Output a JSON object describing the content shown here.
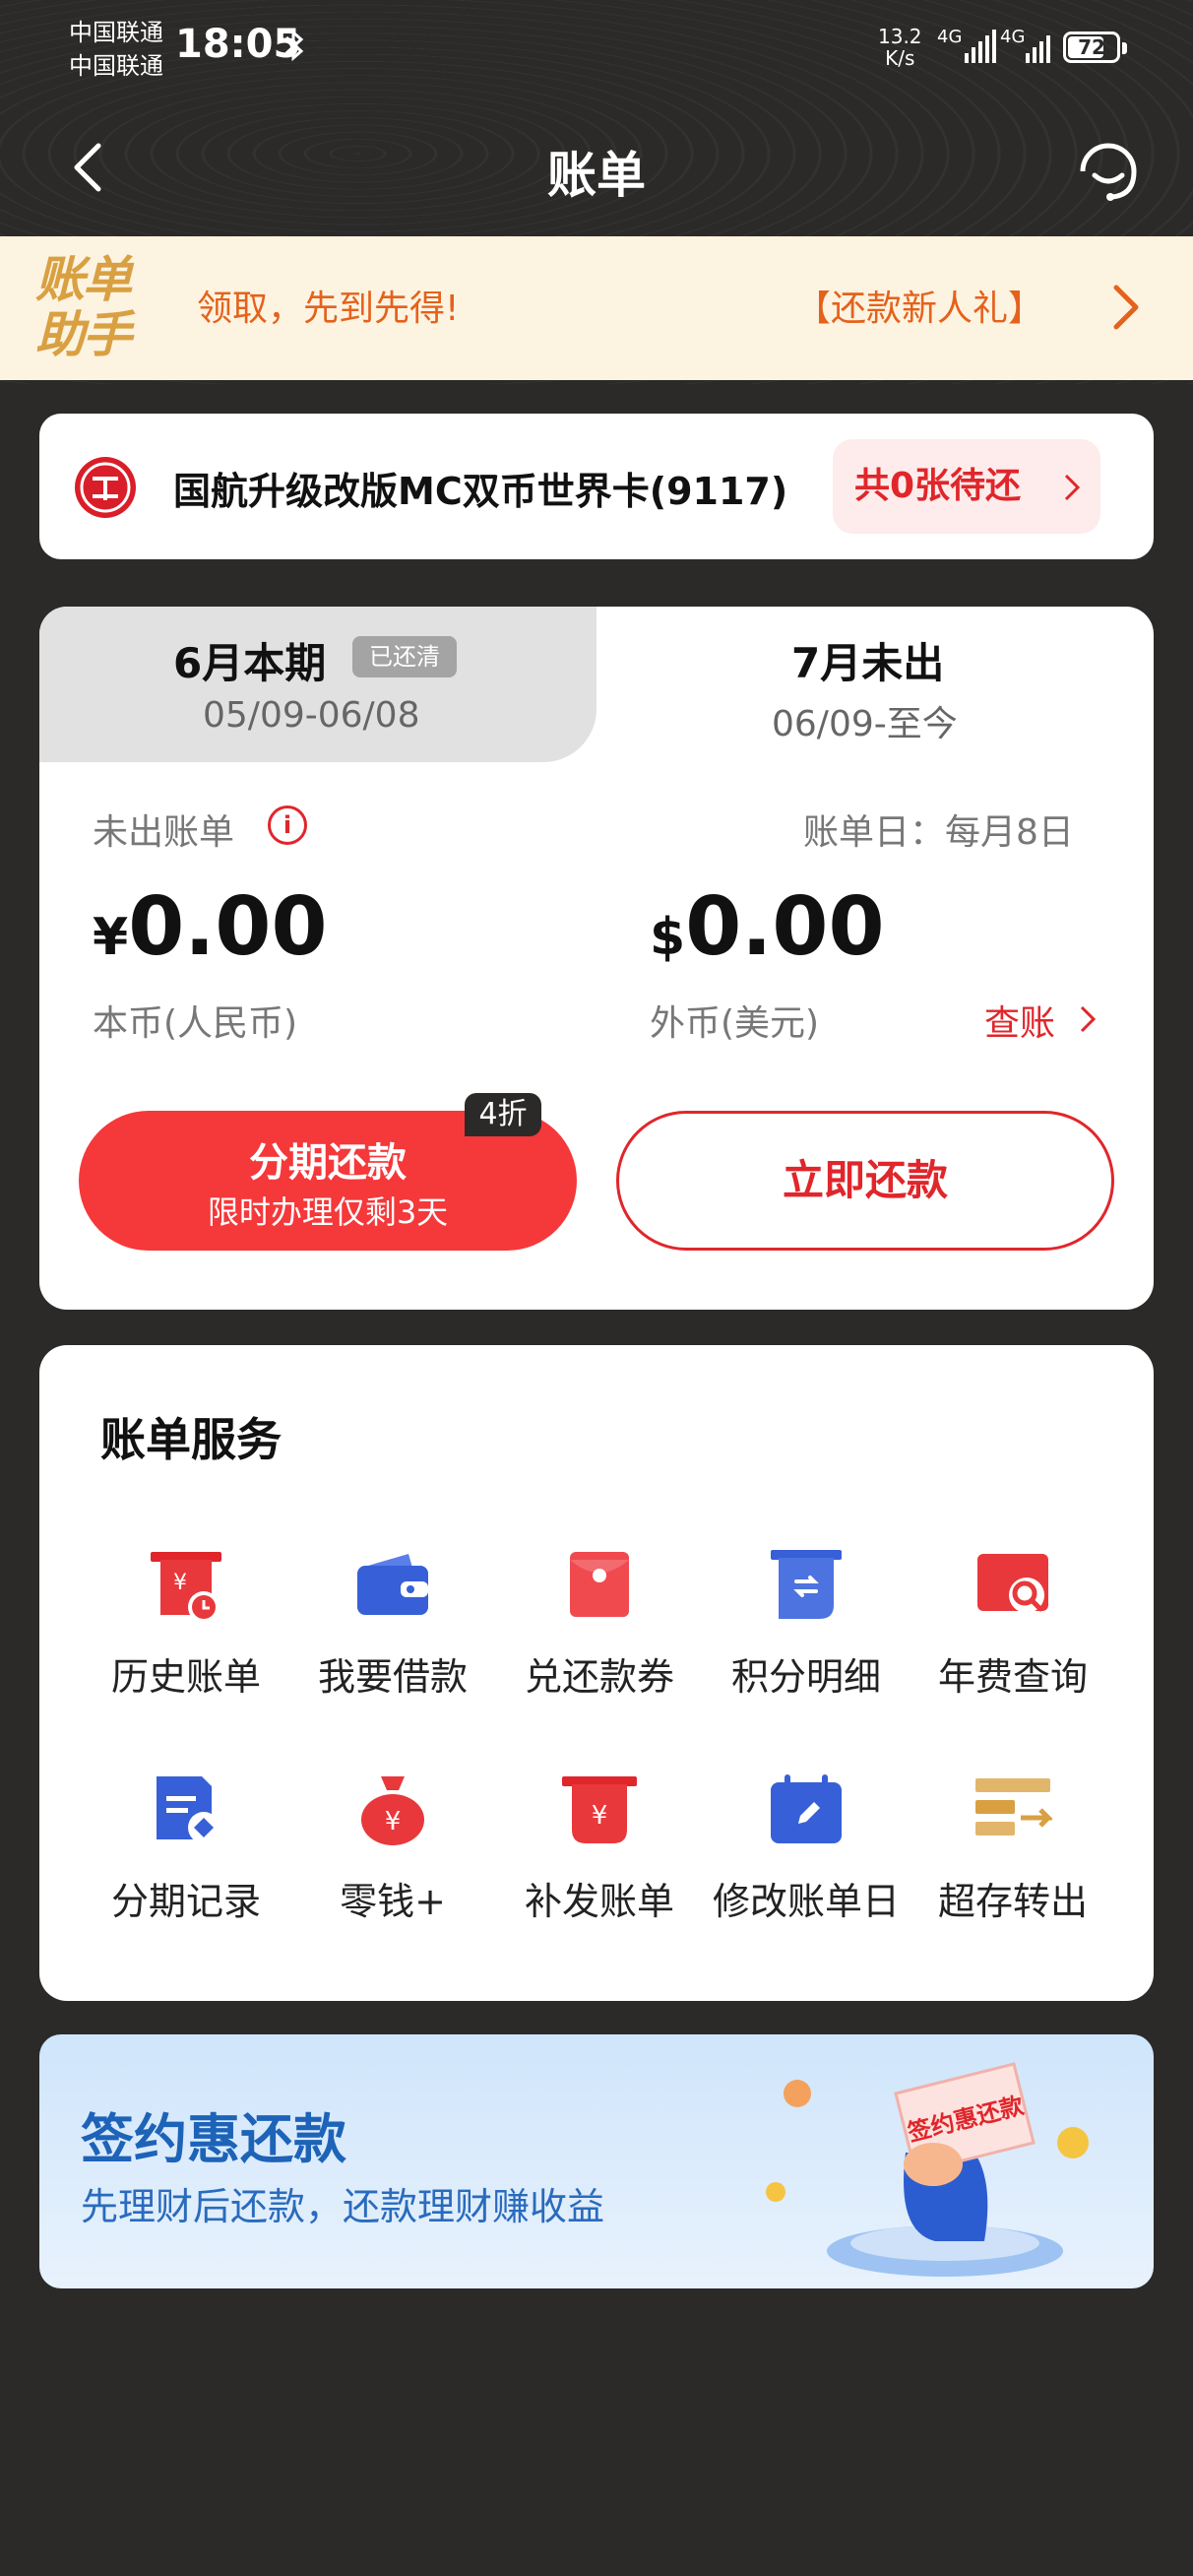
{
  "status_bar": {
    "carrier_1": "中国联通",
    "carrier_2": "中国联通",
    "time": "18:05",
    "net_speed_value": "13.2",
    "net_speed_unit": "K/s",
    "signal_1": "4G",
    "signal_2": "4G",
    "battery": "72"
  },
  "nav": {
    "title": "账单"
  },
  "banner": {
    "logo_line_1": "账单",
    "logo_line_2": "助手",
    "text_left": "领取，先到先得!",
    "text_right": "【还款新人礼】"
  },
  "card": {
    "name": "国航升级改版MC双币世界卡(9117)",
    "pending": "共0张待还"
  },
  "bill": {
    "tab_current_title": "6月本期",
    "tab_current_badge": "已还清",
    "tab_current_range": "05/09-06/08",
    "tab_next_title": "7月未出",
    "tab_next_range": "06/09-至今",
    "status_label": "未出账单",
    "bill_day": "账单日：每月8日",
    "cny_symbol": "¥",
    "cny_amount": "0.00",
    "cny_label": "本币(人民币)",
    "usd_symbol": "$",
    "usd_amount": "0.00",
    "usd_label": "外币(美元)",
    "check_link": "查账",
    "installment_title": "分期还款",
    "installment_sub": "限时办理仅剩3天",
    "discount": "4折",
    "pay_now": "立即还款"
  },
  "services": {
    "title": "账单服务",
    "items": [
      {
        "label": "历史账单",
        "icon": "history-bill-icon"
      },
      {
        "label": "我要借款",
        "icon": "wallet-icon"
      },
      {
        "label": "兑还款券",
        "icon": "red-envelope-icon"
      },
      {
        "label": "积分明细",
        "icon": "points-icon"
      },
      {
        "label": "年费查询",
        "icon": "annual-fee-search-icon"
      },
      {
        "label": "分期记录",
        "icon": "installment-record-icon"
      },
      {
        "label": "零钱+",
        "icon": "money-bag-icon"
      },
      {
        "label": "补发账单",
        "icon": "reissue-bill-icon"
      },
      {
        "label": "修改账单日",
        "icon": "calendar-edit-icon"
      },
      {
        "label": "超存转出",
        "icon": "transfer-out-icon"
      }
    ]
  },
  "promo": {
    "title": "签约惠还款",
    "subtitle": "先理财后还款，还款理财赚收益",
    "card_text": "签约惠还款"
  },
  "colors": {
    "brand_red": "#e0262b",
    "bg_dark": "#2b2a29",
    "banner_bg": "#fdf3e1",
    "promo_blue": "#1d63b8"
  }
}
